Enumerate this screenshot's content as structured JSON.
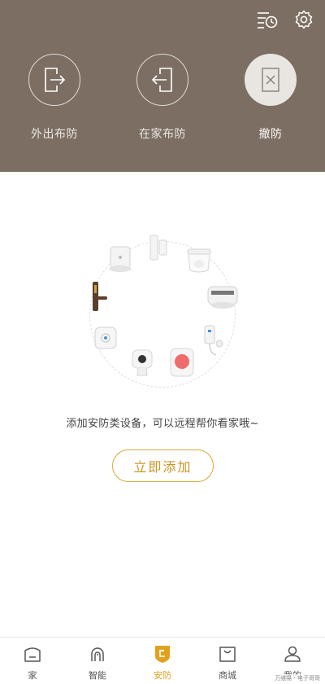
{
  "header": {
    "history_icon": "history-list-icon",
    "settings_icon": "gear-icon"
  },
  "modes": [
    {
      "label": "外出布防",
      "icon": "exit-door-icon",
      "active": false
    },
    {
      "label": "在家布防",
      "icon": "enter-door-icon",
      "active": false
    },
    {
      "label": "撤防",
      "icon": "disarm-icon",
      "active": true
    }
  ],
  "main": {
    "hint": "添加安防类设备，可以远程帮你看家哦~",
    "add_button": "立即添加"
  },
  "tabs": [
    {
      "label": "家",
      "icon": "home-icon",
      "active": false
    },
    {
      "label": "智能",
      "icon": "smart-icon",
      "active": false
    },
    {
      "label": "安防",
      "icon": "shield-icon",
      "active": true
    },
    {
      "label": "商城",
      "icon": "store-icon",
      "active": false
    },
    {
      "label": "我的",
      "icon": "profile-icon",
      "active": false
    }
  ],
  "watermark": "万维易 · 电子哥哥",
  "colors": {
    "header_bg": "#7c6e62",
    "accent": "#d8a836",
    "active_tab": "#e0a21e"
  }
}
